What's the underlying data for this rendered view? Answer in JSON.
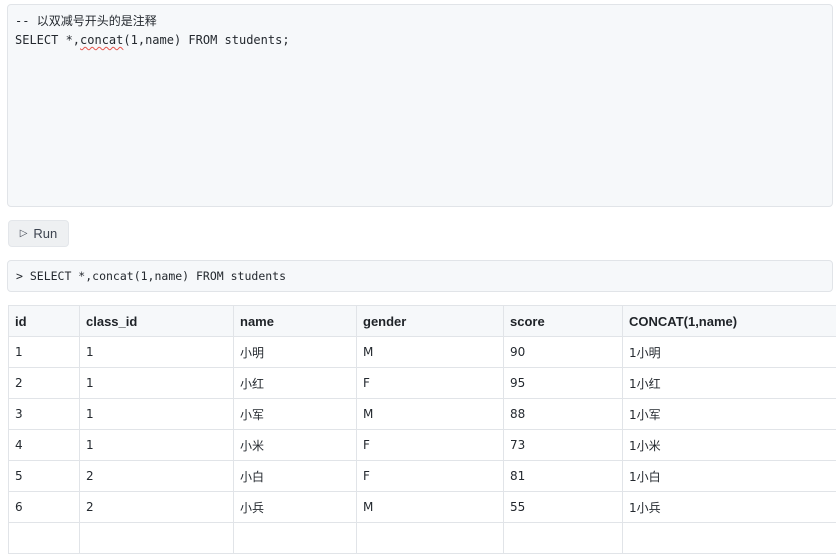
{
  "editor": {
    "lines": [
      {
        "prefix": "-- ",
        "comment": "以双减号开头的是注释",
        "squiggle": "",
        "suffix": ""
      },
      {
        "prefix": "SELECT *,",
        "comment": "",
        "squiggle": "concat",
        "suffix": "(1,name) FROM students;"
      }
    ]
  },
  "run_button": {
    "icon": "▷",
    "label": "Run"
  },
  "query_log": {
    "text": "> SELECT *,concat(1,name) FROM students"
  },
  "table": {
    "headers": [
      "id",
      "class_id",
      "name",
      "gender",
      "score",
      "CONCAT(1,name)"
    ],
    "rows": [
      [
        "1",
        "1",
        "小明",
        "M",
        "90",
        "1小明"
      ],
      [
        "2",
        "1",
        "小红",
        "F",
        "95",
        "1小红"
      ],
      [
        "3",
        "1",
        "小军",
        "M",
        "88",
        "1小军"
      ],
      [
        "4",
        "1",
        "小米",
        "F",
        "73",
        "1小米"
      ],
      [
        "5",
        "2",
        "小白",
        "F",
        "81",
        "1小白"
      ],
      [
        "6",
        "2",
        "小兵",
        "M",
        "55",
        "1小兵"
      ],
      [
        "",
        "",
        "",
        "",
        "",
        ""
      ]
    ]
  }
}
